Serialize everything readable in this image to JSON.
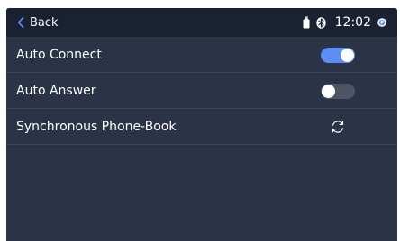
{
  "status_bar": {
    "back_label": "Back",
    "time": "12:02",
    "icons": [
      "chevron-left-icon",
      "usb-icon",
      "bluetooth-icon",
      "p-badge-icon"
    ]
  },
  "settings": {
    "auto_connect": {
      "label": "Auto Connect",
      "enabled": true
    },
    "auto_answer": {
      "label": "Auto Answer",
      "enabled": false
    },
    "phonebook_sync": {
      "label": "Synchronous Phone-Book",
      "icon": "refresh-icon"
    }
  },
  "colors": {
    "screen_background": "#2a3446",
    "status_bar_background": "#1a2130",
    "back_chevron": "#5a8ef0",
    "toggle_on": "#5a8ef0",
    "toggle_off": "#4e5666",
    "text": "#ffffff",
    "row_divider": "#3a4558"
  }
}
